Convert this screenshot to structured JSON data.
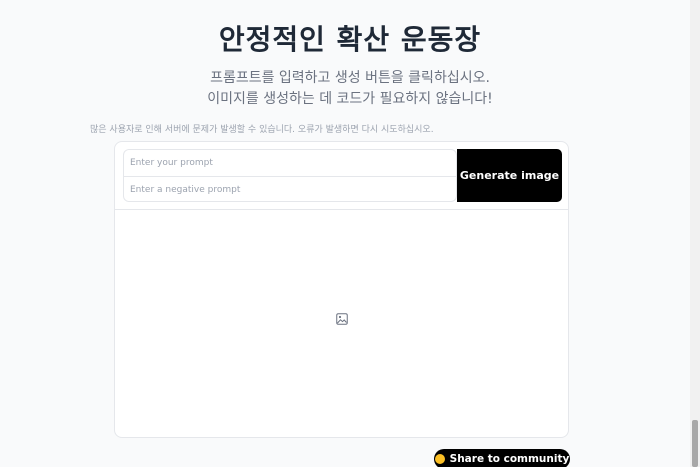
{
  "header": {
    "title": "안정적인 확산 운동장",
    "subtitle_line1": "프롬프트를 입력하고 생성 버튼을 클릭하십시오.",
    "subtitle_line2": "이미지를 생성하는 데 코드가 필요하지 않습니다!"
  },
  "notice": "많은 사용자로 인해 서버에 문제가 발생할 수 있습니다. 오류가 발생하면 다시 시도하십시오.",
  "form": {
    "prompt_placeholder": "Enter your prompt",
    "negative_placeholder": "Enter a negative prompt",
    "generate_label": "Generate image"
  },
  "output": {
    "placeholder_icon": "image-icon"
  },
  "share": {
    "label": "Share to community",
    "icon": "hug-icon",
    "icon_color": "#fbbf24"
  }
}
